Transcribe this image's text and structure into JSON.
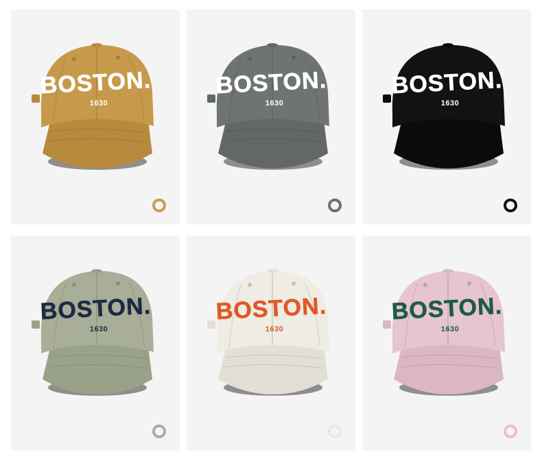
{
  "products": [
    {
      "cap_color": "#c79a4b",
      "brim_color": "#b88a3e",
      "text_color": "#ffffff",
      "outline_color": "#ffffff",
      "swatch_color": "#c99d52",
      "title": "BOSTON.",
      "year": "1630"
    },
    {
      "cap_color": "#6f7472",
      "brim_color": "#636866",
      "text_color": "#ffffff",
      "outline_color": "#ffffff",
      "swatch_color": "#6c7170",
      "title": "BOSTON.",
      "year": "1630"
    },
    {
      "cap_color": "#121212",
      "brim_color": "#0b0b0b",
      "text_color": "#ffffff",
      "outline_color": "#ffffff",
      "swatch_color": "#111111",
      "title": "BOSTON.",
      "year": "1630"
    },
    {
      "cap_color": "#a8ae97",
      "brim_color": "#9aa189",
      "text_color": "#1e2a45",
      "outline_color": "#1e2a45",
      "swatch_color": "#a9af98",
      "title": "BOSTON.",
      "year": "1630"
    },
    {
      "cap_color": "#efece3",
      "brim_color": "#e3dfd4",
      "text_color": "#e0582a",
      "outline_color": "#e0582a",
      "swatch_color": "#ece8dd",
      "title": "BOSTON.",
      "year": "1630"
    },
    {
      "cap_color": "#e6c5d0",
      "brim_color": "#dcb6c3",
      "text_color": "#1d5a4a",
      "outline_color": "#1d5a4a",
      "swatch_color": "#e8c1cd",
      "title": "BOSTON.",
      "year": "1630"
    }
  ]
}
